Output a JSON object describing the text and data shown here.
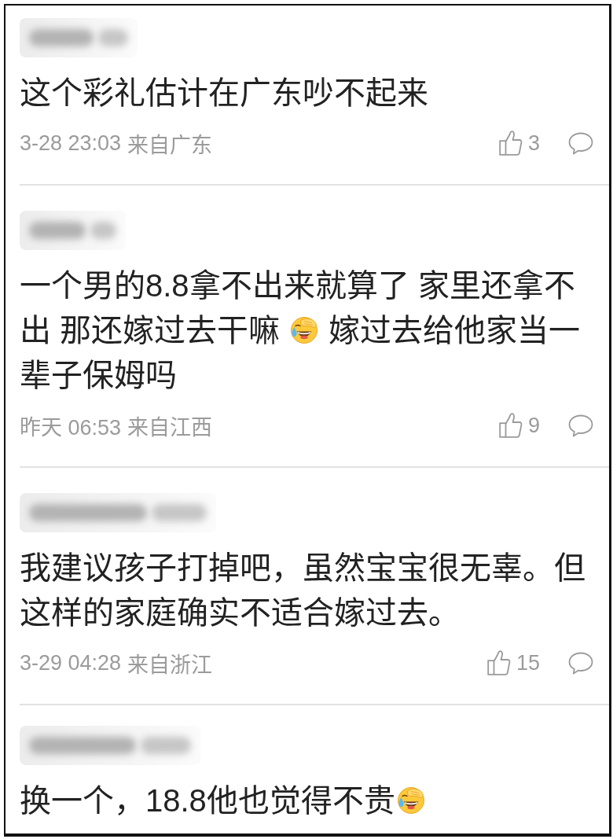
{
  "comments": [
    {
      "content": [
        {
          "kind": "text",
          "text": "这个彩礼估计在广东吵不起来"
        }
      ],
      "time": "3-28 23:03",
      "location": "来自广东",
      "likes": "3"
    },
    {
      "content": [
        {
          "kind": "text",
          "text": "一个男的8.8拿不出来就算了 家里还拿不出 那还嫁过去干嘛 "
        },
        {
          "kind": "emoji"
        },
        {
          "kind": "text",
          "text": " 嫁过去给他家当一辈子保姆吗"
        }
      ],
      "time": "昨天 06:53",
      "location": "来自江西",
      "likes": "9"
    },
    {
      "content": [
        {
          "kind": "text",
          "text": "我建议孩子打掉吧，虽然宝宝很无辜。但这样的家庭确实不适合嫁过去。"
        }
      ],
      "time": "3-29 04:28",
      "location": "来自浙江",
      "likes": "15"
    },
    {
      "content": [
        {
          "kind": "text",
          "text": "换一个，18.8他也觉得不贵"
        },
        {
          "kind": "emoji"
        }
      ]
    }
  ]
}
